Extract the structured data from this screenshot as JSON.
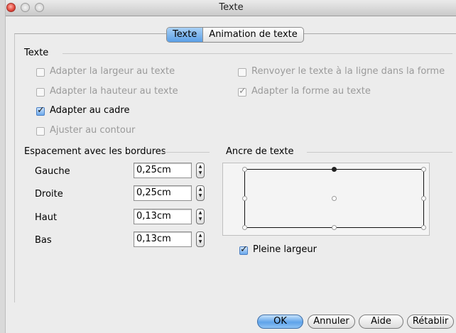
{
  "window": {
    "title": "Texte"
  },
  "tabs": [
    {
      "label": "Texte",
      "active": true
    },
    {
      "label": "Animation de texte",
      "active": false
    }
  ],
  "text_section": {
    "heading": "Texte",
    "options": [
      {
        "label": "Adapter la largeur au texte",
        "checked": false,
        "enabled": false
      },
      {
        "label": "Adapter la hauteur au texte",
        "checked": false,
        "enabled": false
      },
      {
        "label": "Adapter au cadre",
        "checked": true,
        "enabled": true
      },
      {
        "label": "Ajuster au contour",
        "checked": false,
        "enabled": false
      },
      {
        "label": "Renvoyer le texte à la ligne dans la forme",
        "checked": false,
        "enabled": false
      },
      {
        "label": "Adapter la forme au texte",
        "checked": true,
        "enabled": false
      }
    ]
  },
  "spacing": {
    "heading": "Espacement avec les bordures",
    "rows": [
      {
        "label": "Gauche",
        "value": "0,25cm"
      },
      {
        "label": "Droite",
        "value": "0,25cm"
      },
      {
        "label": "Haut",
        "value": "0,13cm"
      },
      {
        "label": "Bas",
        "value": "0,13cm"
      }
    ]
  },
  "anchor": {
    "heading": "Ancre de texte",
    "selected": "top-center",
    "full_width_label": "Pleine largeur",
    "full_width_checked": true
  },
  "buttons": {
    "ok": "OK",
    "cancel": "Annuler",
    "help": "Aide",
    "reset": "Rétablir"
  },
  "colors": {
    "accent": "#5fa3ea",
    "close_button": "#e0453a"
  }
}
